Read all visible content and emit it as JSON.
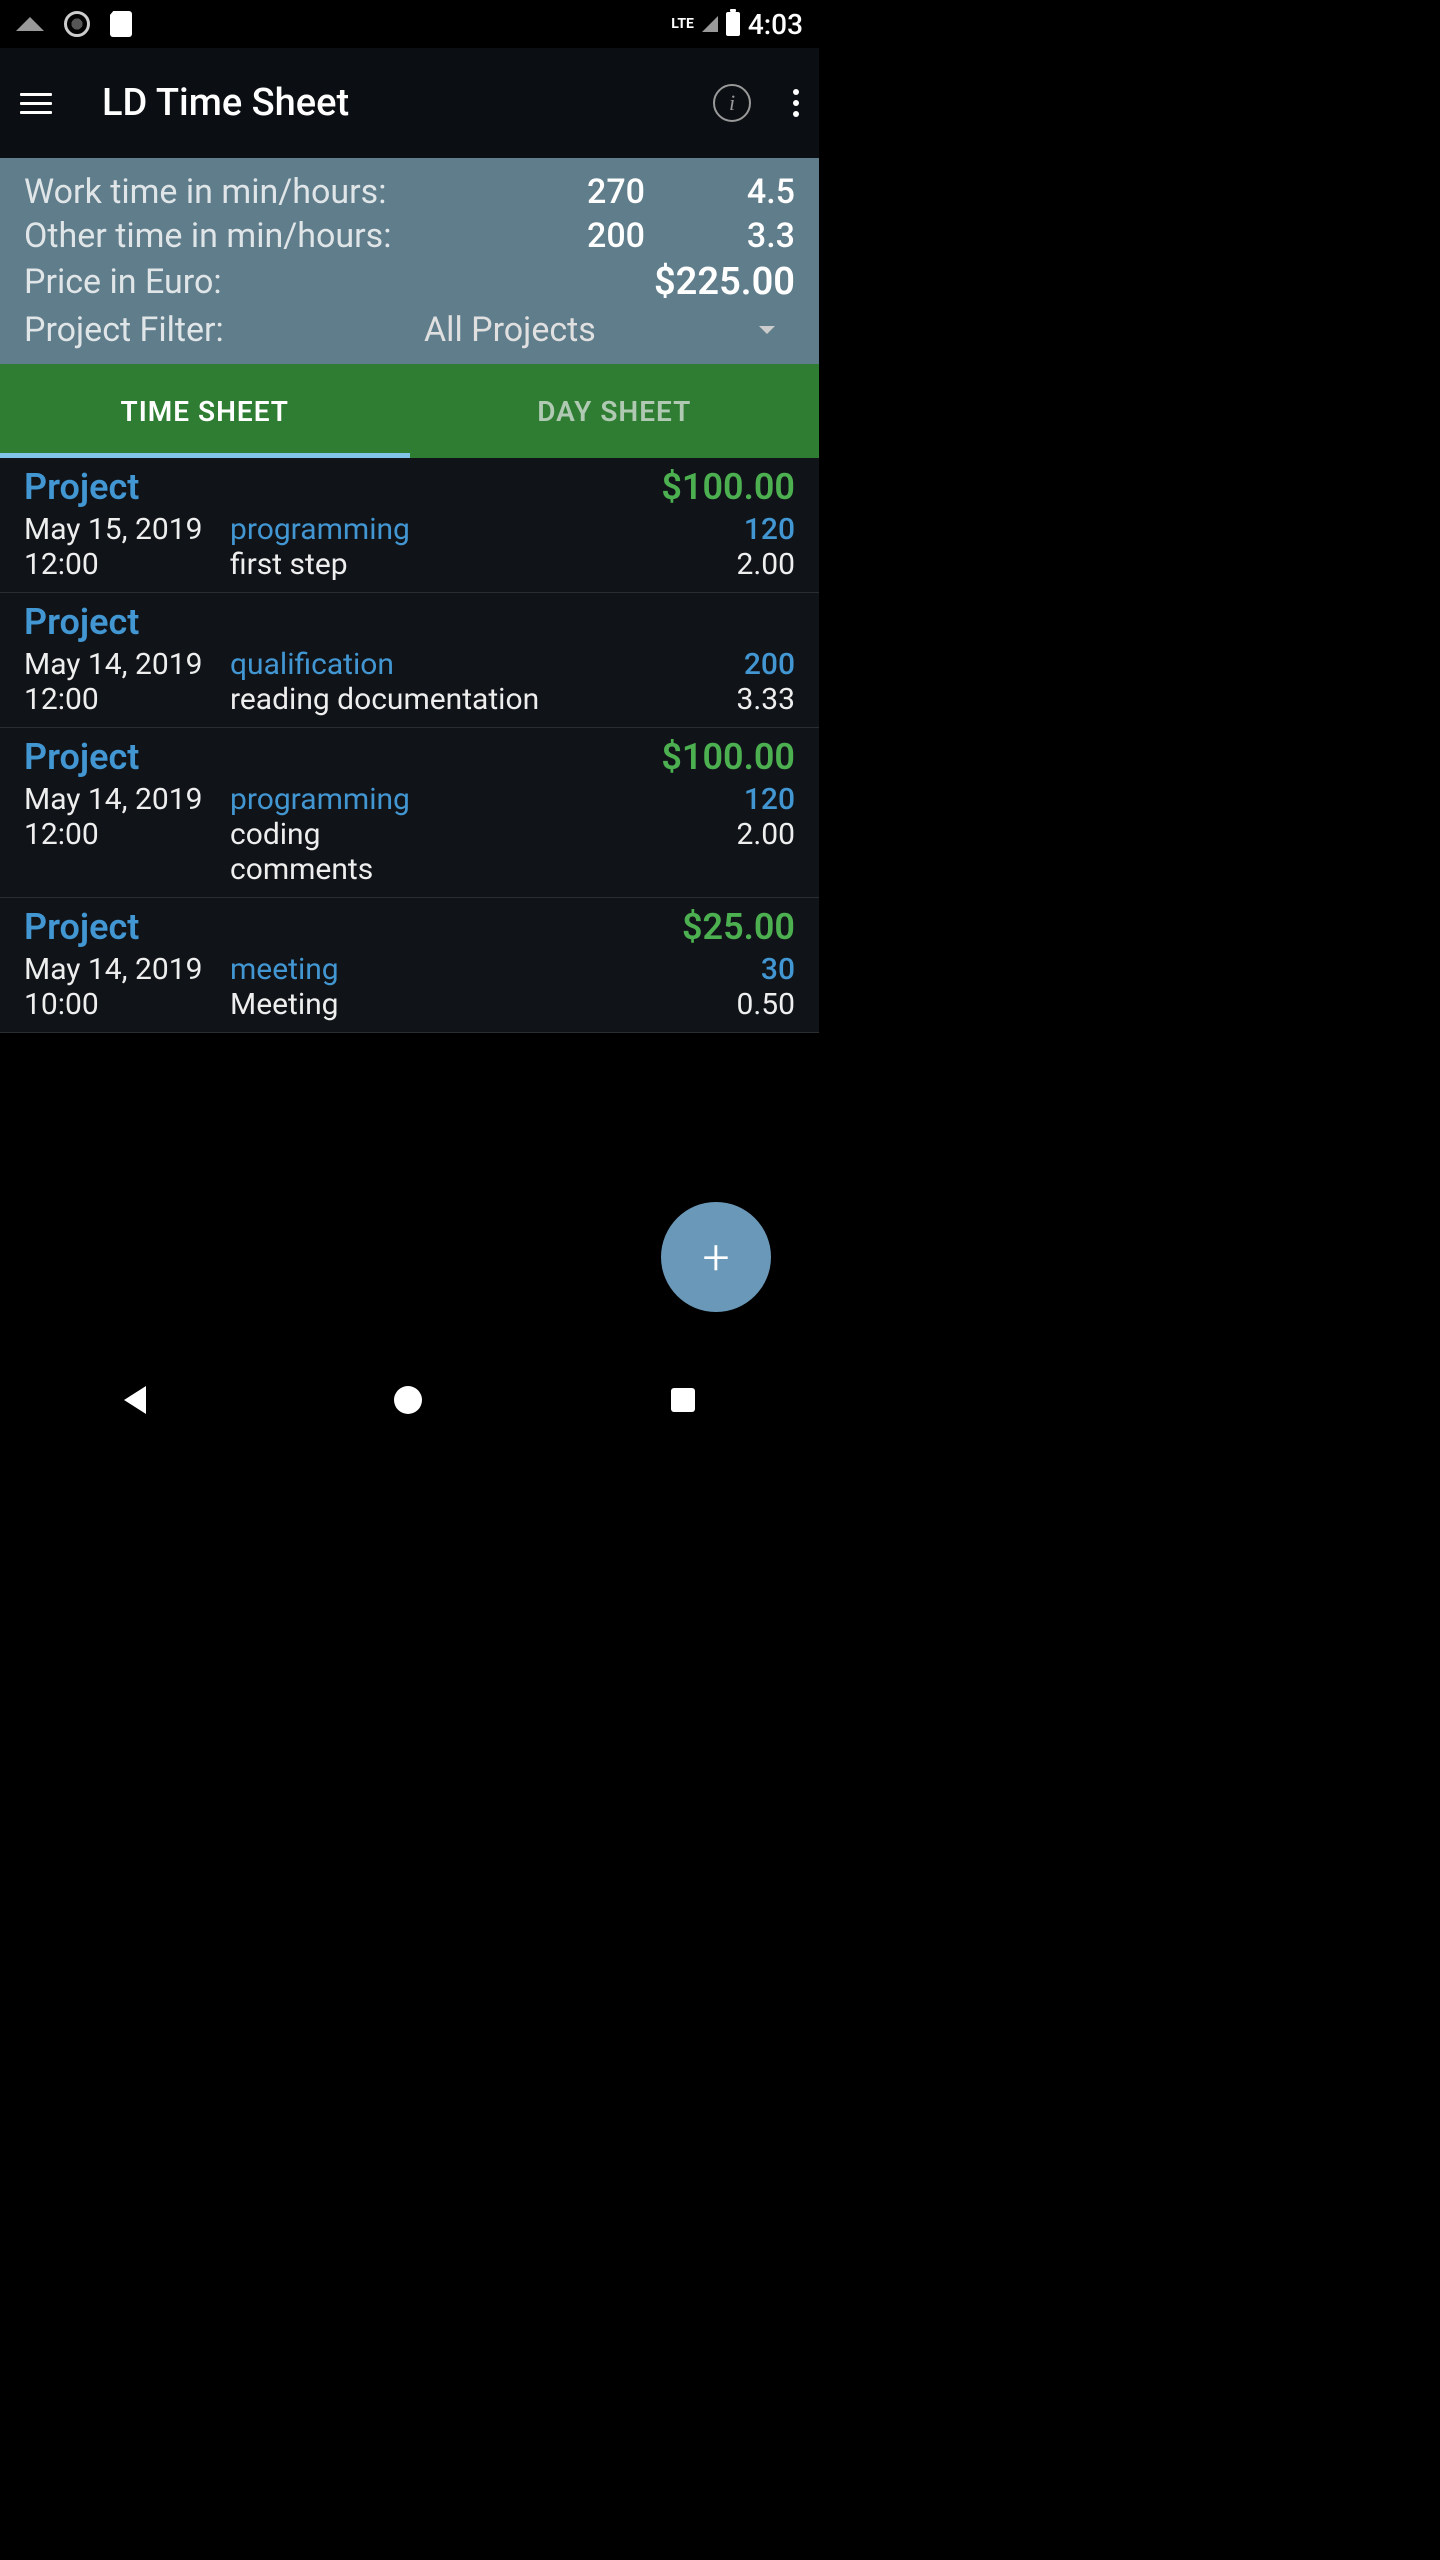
{
  "statusBar": {
    "lte": "LTE",
    "time": "4:03"
  },
  "appBar": {
    "title": "LD Time Sheet"
  },
  "summary": {
    "workLabel": "Work time in min/hours:",
    "workMin": "270",
    "workHrs": "4.5",
    "otherLabel": "Other time in min/hours:",
    "otherMin": "200",
    "otherHrs": "3.3",
    "priceLabel": "Price in Euro:",
    "priceVal": "$225.00",
    "filterLabel": "Project Filter:",
    "filterValue": "All Projects"
  },
  "tabs": {
    "timeSheet": "TIME SHEET",
    "daySheet": "DAY SHEET"
  },
  "entries": [
    {
      "project": "Project",
      "price": "$100.00",
      "date": "May 15, 2019",
      "time": "12:00",
      "category": "programming",
      "desc": "first step",
      "min": "120",
      "hrs": "2.00",
      "extra": null
    },
    {
      "project": "Project",
      "price": "",
      "date": "May 14, 2019",
      "time": "12:00",
      "category": "qualification",
      "desc": "reading documentation",
      "min": "200",
      "hrs": "3.33",
      "extra": null
    },
    {
      "project": "Project",
      "price": "$100.00",
      "date": "May 14, 2019",
      "time": "12:00",
      "category": "programming",
      "desc": "coding",
      "min": "120",
      "hrs": "2.00",
      "extra": " comments"
    },
    {
      "project": "Project",
      "price": "$25.00",
      "date": "May 14, 2019",
      "time": "10:00",
      "category": "meeting",
      "desc": "Meeting",
      "min": "30",
      "hrs": "0.50",
      "extra": null
    }
  ],
  "fab": {
    "label": "+"
  }
}
